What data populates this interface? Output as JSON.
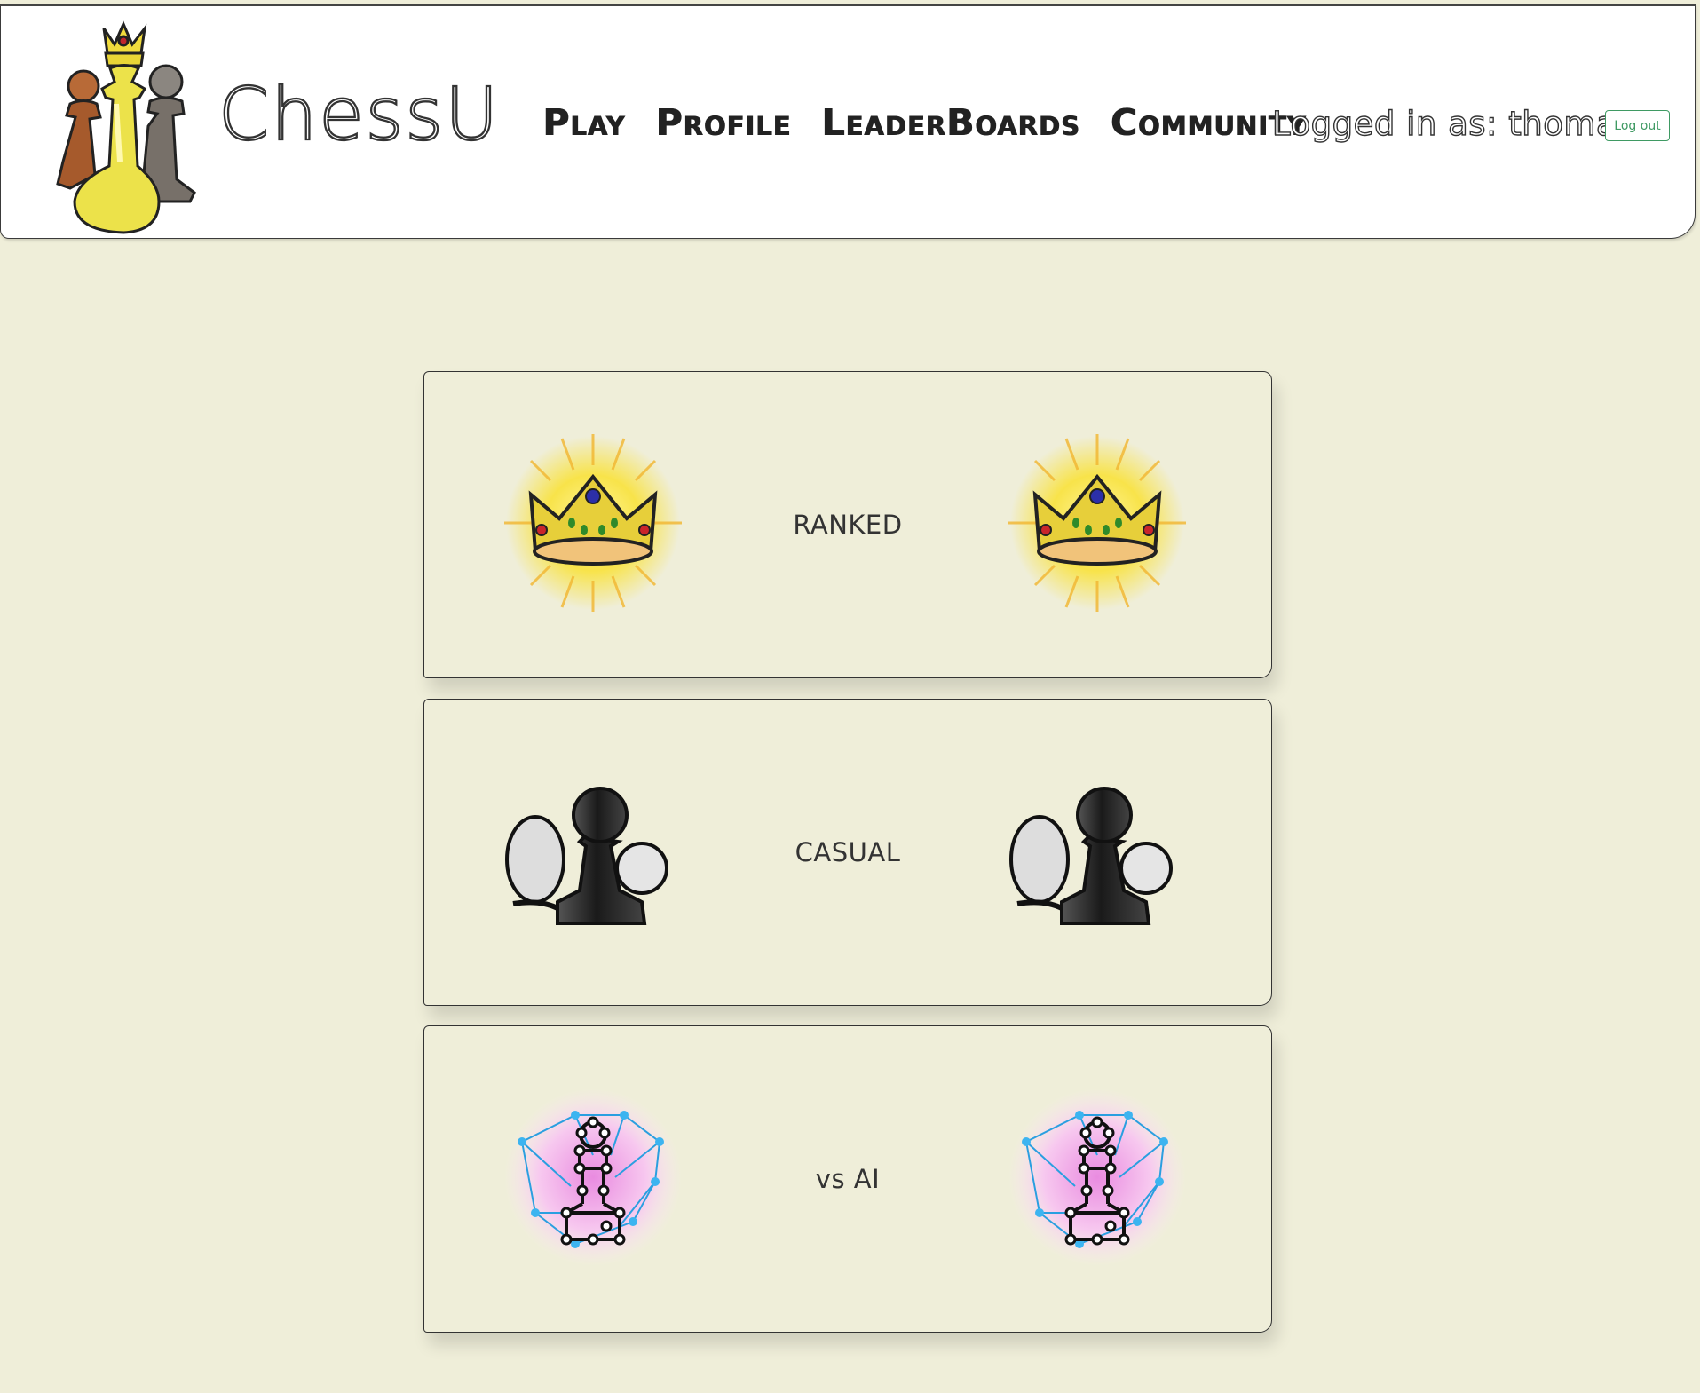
{
  "header": {
    "brand": "ChessU",
    "nav": [
      {
        "label": "Play"
      },
      {
        "label": "Profile"
      },
      {
        "label": "LeaderBoards"
      },
      {
        "label": "Community"
      }
    ],
    "login_text": "Logged in as: thomas",
    "logout_label": "Log out"
  },
  "modes": [
    {
      "label": "RANKED",
      "icon": "crown-icon"
    },
    {
      "label": "CASUAL",
      "icon": "pawn-icon"
    },
    {
      "label": "vs AI",
      "icon": "ai-pawn-icon"
    }
  ],
  "colors": {
    "background": "#efeed9",
    "header_bg": "#ffffff",
    "logout_accent": "#3f9a63",
    "crown_gold": "#e7cf3a",
    "ai_blue": "#2a9fe0",
    "ai_pink": "#f4b5e4"
  }
}
